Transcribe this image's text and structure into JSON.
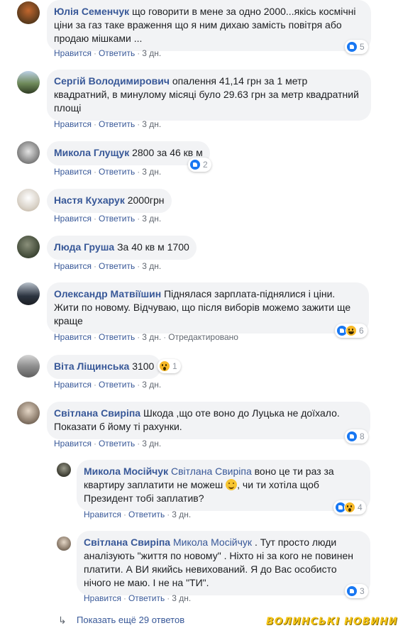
{
  "actions": {
    "like": "Нравится",
    "reply": "Ответить",
    "edited": "Отредактировано"
  },
  "colors": {
    "link": "#385898",
    "bubble": "#f2f3f5",
    "like": "#1877f2",
    "emoji": "#f7b928"
  },
  "comments": [
    {
      "author": "Юлія Семенчук",
      "text": "що говорити в мене за одно 2000...якісь космічні ціни за газ таке враження що я ним дихаю замість повітря або продаю мішками ...",
      "time": "3 дн.",
      "reactions": {
        "icons": [
          "like-icon"
        ],
        "count": "5"
      }
    },
    {
      "author": "Сергій Володимирович",
      "text": "опалення 41,14 грн за 1 метр квадратний, в минулому місяці було 29.63 грн за метр квадратний площі",
      "time": "3 дн."
    },
    {
      "author": "Микола Глущук",
      "text": "2800 за 46 кв м",
      "time": "3 дн.",
      "reactions": {
        "icons": [
          "like-icon"
        ],
        "count": "2"
      }
    },
    {
      "author": "Настя Кухарук",
      "text": "2000грн",
      "time": "3 дн."
    },
    {
      "author": "Люда Груша",
      "text": "За 40 кв м 1700",
      "time": "3 дн."
    },
    {
      "author": "Олександр Матвіїшин",
      "text": "Піднялася зарплата-піднялися і ціни. Жити по новому. Відчуваю, що після виборів можемо зажити ще краще",
      "time": "3 дн.",
      "reactions": {
        "icons": [
          "like-icon",
          "haha-icon"
        ],
        "count": "6"
      }
    },
    {
      "author": "Віта Ліщинська",
      "text": "3100",
      "time": "3 дн.",
      "reactions": {
        "icons": [
          "wow-icon"
        ],
        "count": "1"
      }
    },
    {
      "author": "Світлана Свиріпа",
      "text": "Шкода ,що оте воно до Луцька не доїхало. Показати б йому ті рахунки.",
      "time": "3 дн.",
      "reactions": {
        "icons": [
          "like-icon"
        ],
        "count": "8"
      }
    }
  ],
  "replies": [
    {
      "author": "Микола Мосійчук",
      "mention": "Світлана Свиріпа",
      "text_part1": "воно це ти раз за квартиру заплатити не можеш",
      "text_part2": ", чи ти хотіла щоб Президент тобі заплатив?",
      "time": "3 дн.",
      "reactions": {
        "icons": [
          "like-icon",
          "wow-icon"
        ],
        "count": "4"
      }
    },
    {
      "author": "Світлана Свиріпа",
      "mention": "Микола Мосійчук",
      "text": ". Тут просто люди аналізують \"життя по новому\" . Ніхто ні за кого не повинен платити. А ВИ якийсь невихований. Я до Вас особисто нічого не маю. І не на \"ТИ\".",
      "time": "3 дн.",
      "reactions": {
        "icons": [
          "like-icon"
        ],
        "count": "3"
      }
    }
  ],
  "more_replies": "Показать ещё 29 ответов",
  "watermark": "ВОЛИНСЬКІ НОВИНИ"
}
